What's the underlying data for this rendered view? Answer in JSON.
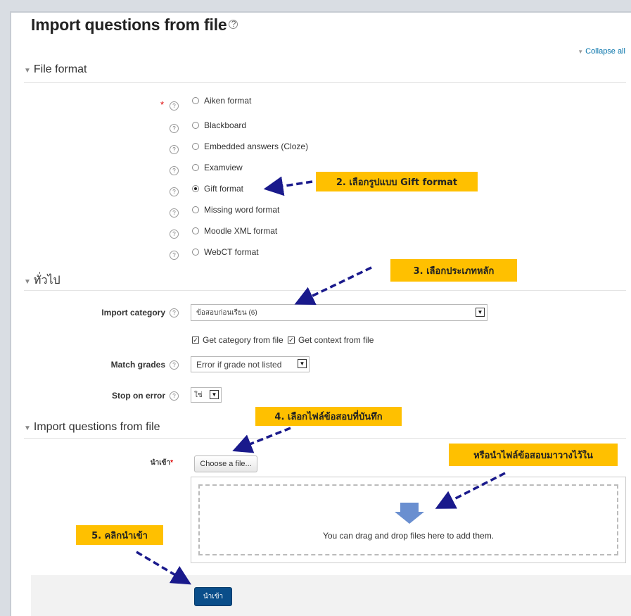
{
  "page": {
    "title": "Import questions from file",
    "collapse_all": "Collapse all"
  },
  "file_format": {
    "legend": "File format",
    "required_mark": "*",
    "options": [
      {
        "label": "Aiken format",
        "selected": false
      },
      {
        "label": "Blackboard",
        "selected": false
      },
      {
        "label": "Embedded answers (Cloze)",
        "selected": false
      },
      {
        "label": "Examview",
        "selected": false
      },
      {
        "label": "Gift format",
        "selected": true
      },
      {
        "label": "Missing word format",
        "selected": false
      },
      {
        "label": "Moodle XML format",
        "selected": false
      },
      {
        "label": "WebCT format",
        "selected": false
      }
    ]
  },
  "general": {
    "legend": "ทั่วไป",
    "import_category_label": "Import category",
    "import_category_value": "ข้อสอบก่อนเรียน (6)",
    "get_category_label": "Get category from file",
    "get_context_label": "Get context from file",
    "match_grades_label": "Match grades",
    "match_grades_value": "Error if grade not listed",
    "stop_on_error_label": "Stop on error",
    "stop_on_error_value": "ใช่"
  },
  "import_section": {
    "legend": "Import questions from file",
    "file_label": "นำเข้า",
    "required_mark": "*",
    "choose_button": "Choose a file...",
    "drop_text": "You can drag and drop files here to add them.",
    "submit_button": "นำเข้า"
  },
  "annotations": {
    "step2": "2. เลือกรูปแบบ Gift format",
    "step3": "3. เลือกประเภทหลัก",
    "step4": "4. เลือกไฟล์ข้อสอบที่บันทึก",
    "or_drop": "หรือนำไฟล์ข้อสอบมาวางไว้ใน",
    "step5": "5. คลิกนำเข้า"
  },
  "colors": {
    "callout": "#ffc000",
    "arrow": "#1a1a8c",
    "submit": "#0a4e8a",
    "link": "#0070a8"
  }
}
